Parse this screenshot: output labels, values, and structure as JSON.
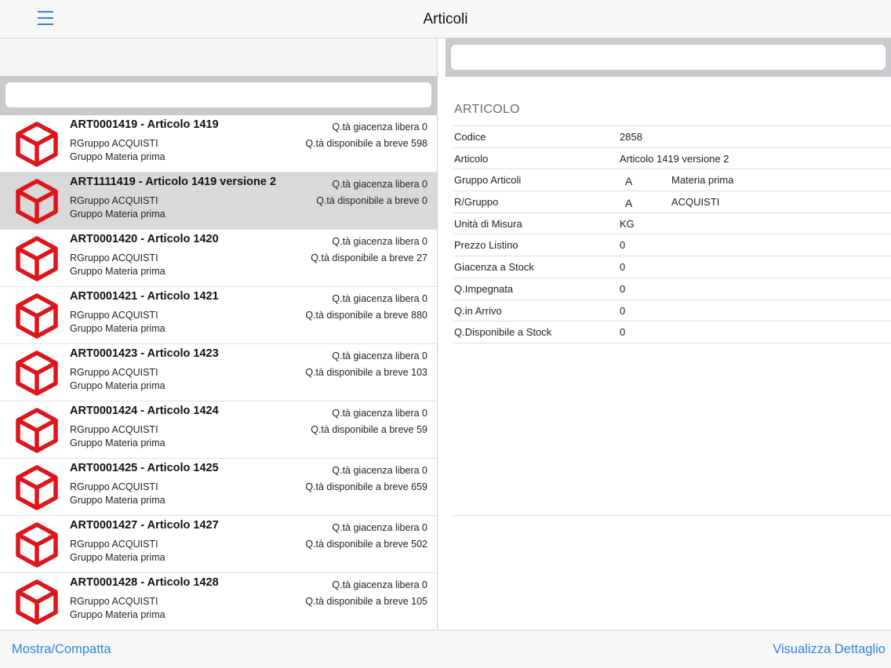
{
  "header": {
    "title": "Articoli",
    "menu_icon": "hamburger-icon"
  },
  "colors": {
    "accent": "#2f86d9",
    "cube": "#e0141b",
    "search_bg": "#c9c9ce",
    "selected_row": "#d9d9d9"
  },
  "left_search": {
    "placeholder": ""
  },
  "right_search": {
    "placeholder": ""
  },
  "list": {
    "items": [
      {
        "title": "ART0001419 - Articolo 1419",
        "sub1": "RGruppo ACQUISTI",
        "sub2": "Gruppo Materia prima",
        "q1": "Q.tà giacenza libera 0",
        "q2": "Q.tà disponibile a breve 598",
        "selected": false
      },
      {
        "title": "ART1111419 - Articolo 1419 versione 2",
        "sub1": "RGruppo ACQUISTI",
        "sub2": "Gruppo Materia prima",
        "q1": "Q.tà giacenza libera 0",
        "q2": "Q.tà disponibile a breve 0",
        "selected": true
      },
      {
        "title": "ART0001420 - Articolo 1420",
        "sub1": "RGruppo ACQUISTI",
        "sub2": "Gruppo Materia prima",
        "q1": "Q.tà giacenza libera 0",
        "q2": "Q.tà disponibile a breve 27",
        "selected": false
      },
      {
        "title": "ART0001421 - Articolo 1421",
        "sub1": "RGruppo ACQUISTI",
        "sub2": "Gruppo Materia prima",
        "q1": "Q.tà giacenza libera 0",
        "q2": "Q.tà disponibile a breve 880",
        "selected": false
      },
      {
        "title": "ART0001423 - Articolo 1423",
        "sub1": "RGruppo ACQUISTI",
        "sub2": "Gruppo Materia prima",
        "q1": "Q.tà giacenza libera 0",
        "q2": "Q.tà disponibile a breve 103",
        "selected": false
      },
      {
        "title": "ART0001424 - Articolo 1424",
        "sub1": "RGruppo ACQUISTI",
        "sub2": "Gruppo Materia prima",
        "q1": "Q.tà giacenza libera 0",
        "q2": "Q.tà disponibile a breve 59",
        "selected": false
      },
      {
        "title": "ART0001425 - Articolo 1425",
        "sub1": "RGruppo ACQUISTI",
        "sub2": "Gruppo Materia prima",
        "q1": "Q.tà giacenza libera 0",
        "q2": "Q.tà disponibile a breve 659",
        "selected": false
      },
      {
        "title": "ART0001427 - Articolo 1427",
        "sub1": "RGruppo ACQUISTI",
        "sub2": "Gruppo Materia prima",
        "q1": "Q.tà giacenza libera 0",
        "q2": "Q.tà disponibile a breve 502",
        "selected": false
      },
      {
        "title": "ART0001428 - Articolo 1428",
        "sub1": "RGruppo ACQUISTI",
        "sub2": "Gruppo Materia prima",
        "q1": "Q.tà giacenza libera 0",
        "q2": "Q.tà disponibile a breve 105",
        "selected": false
      }
    ]
  },
  "detail": {
    "section_title": "ARTICOLO",
    "fields": [
      {
        "label": "Codice",
        "value": "2858"
      },
      {
        "label": "Articolo",
        "value": "Articolo 1419 versione 2"
      },
      {
        "label": "Gruppo Articoli",
        "code": "A",
        "desc": "Materia prima"
      },
      {
        "label": "R/Gruppo",
        "code": "A",
        "desc": "ACQUISTI"
      },
      {
        "label": "Unità di Misura",
        "value": "KG"
      },
      {
        "label": "Prezzo Listino",
        "value": "0"
      },
      {
        "label": "Giacenza a Stock",
        "value": "0"
      },
      {
        "label": "Q.Impegnata",
        "value": "0"
      },
      {
        "label": "Q.in Arrivo",
        "value": "0"
      },
      {
        "label": "Q.Disponibile a Stock",
        "value": "0"
      }
    ]
  },
  "toolbar": {
    "left_label": "Mostra/Compatta",
    "right_label": "Visualizza Dettaglio"
  }
}
